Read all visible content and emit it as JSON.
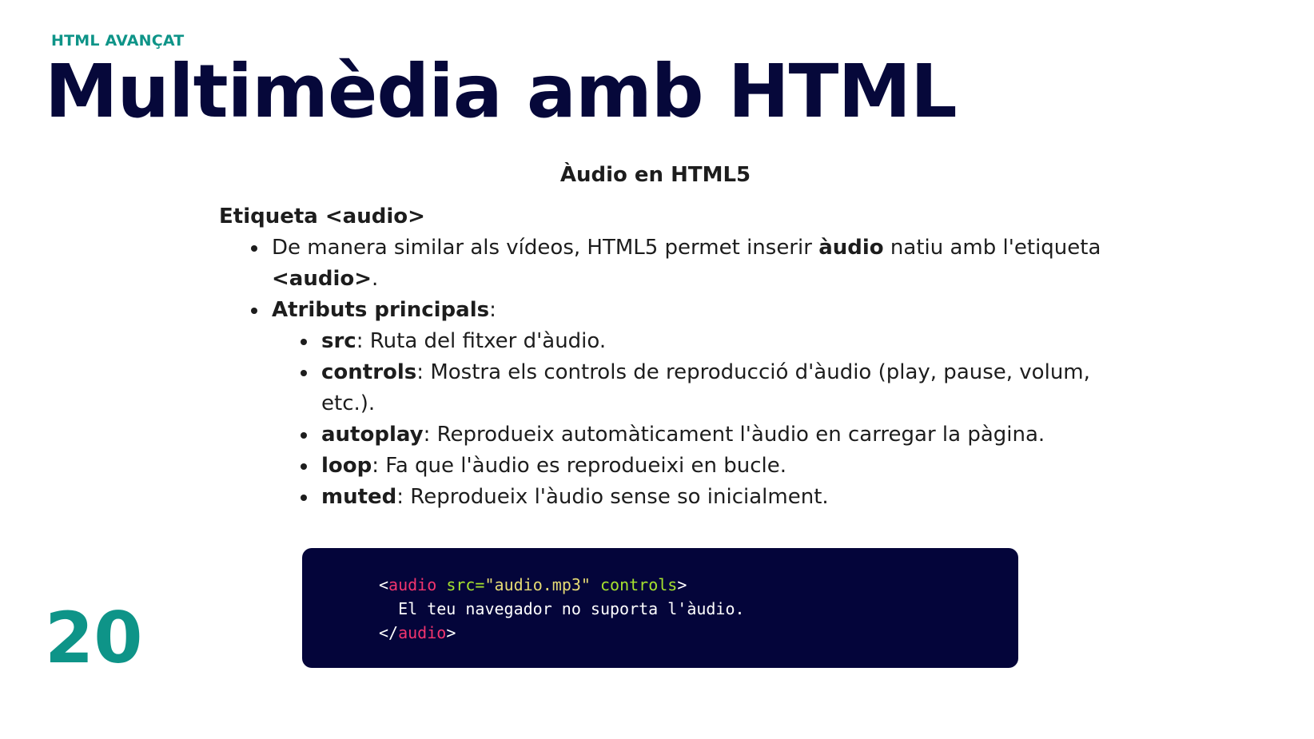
{
  "header": {
    "kicker": "HTML AVANÇAT",
    "title": "Multimèdia amb HTML"
  },
  "slide": {
    "page_number": "20",
    "section_title": "Àudio en HTML5",
    "subheading": "Etiqueta <audio>",
    "bullet1": {
      "text_a": "De manera similar als vídeos, HTML5 permet inserir ",
      "bold": "àudio",
      "text_b": " natiu amb l'etiqueta ",
      "bold2": "<audio>",
      "text_c": "."
    },
    "bullet2": {
      "bold": "Atributs principals",
      "text": ":"
    },
    "attributes": [
      {
        "name": "src",
        "desc": ": Ruta del fitxer d'àudio."
      },
      {
        "name": "controls",
        "desc": ": Mostra els controls de reproducció d'àudio (play, pause, volum, etc.)."
      },
      {
        "name": "autoplay",
        "desc": ": Reprodueix automàticament l'àudio en carregar la pàgina."
      },
      {
        "name": "loop",
        "desc": ": Fa que l'àudio es reprodueixi en bucle."
      },
      {
        "name": "muted",
        "desc": ": Reprodueix l'àudio sense so inicialment."
      }
    ]
  },
  "code": {
    "open_lt": "<",
    "tag": "audio",
    "space1": " ",
    "attr1": "src=",
    "val1": "\"audio.mp3\"",
    "space2": " ",
    "attr2": "controls",
    "open_gt": ">",
    "line2": "  El teu navegador no suporta l'àudio.",
    "close_lt": "</",
    "close_tag": "audio",
    "close_gt": ">"
  },
  "colors": {
    "accent_teal": "#0e9488",
    "title_navy": "#06083a",
    "code_bg": "#04053a",
    "code_tag": "#f2346e",
    "code_attr": "#a6e22e",
    "code_string": "#e6db74"
  }
}
